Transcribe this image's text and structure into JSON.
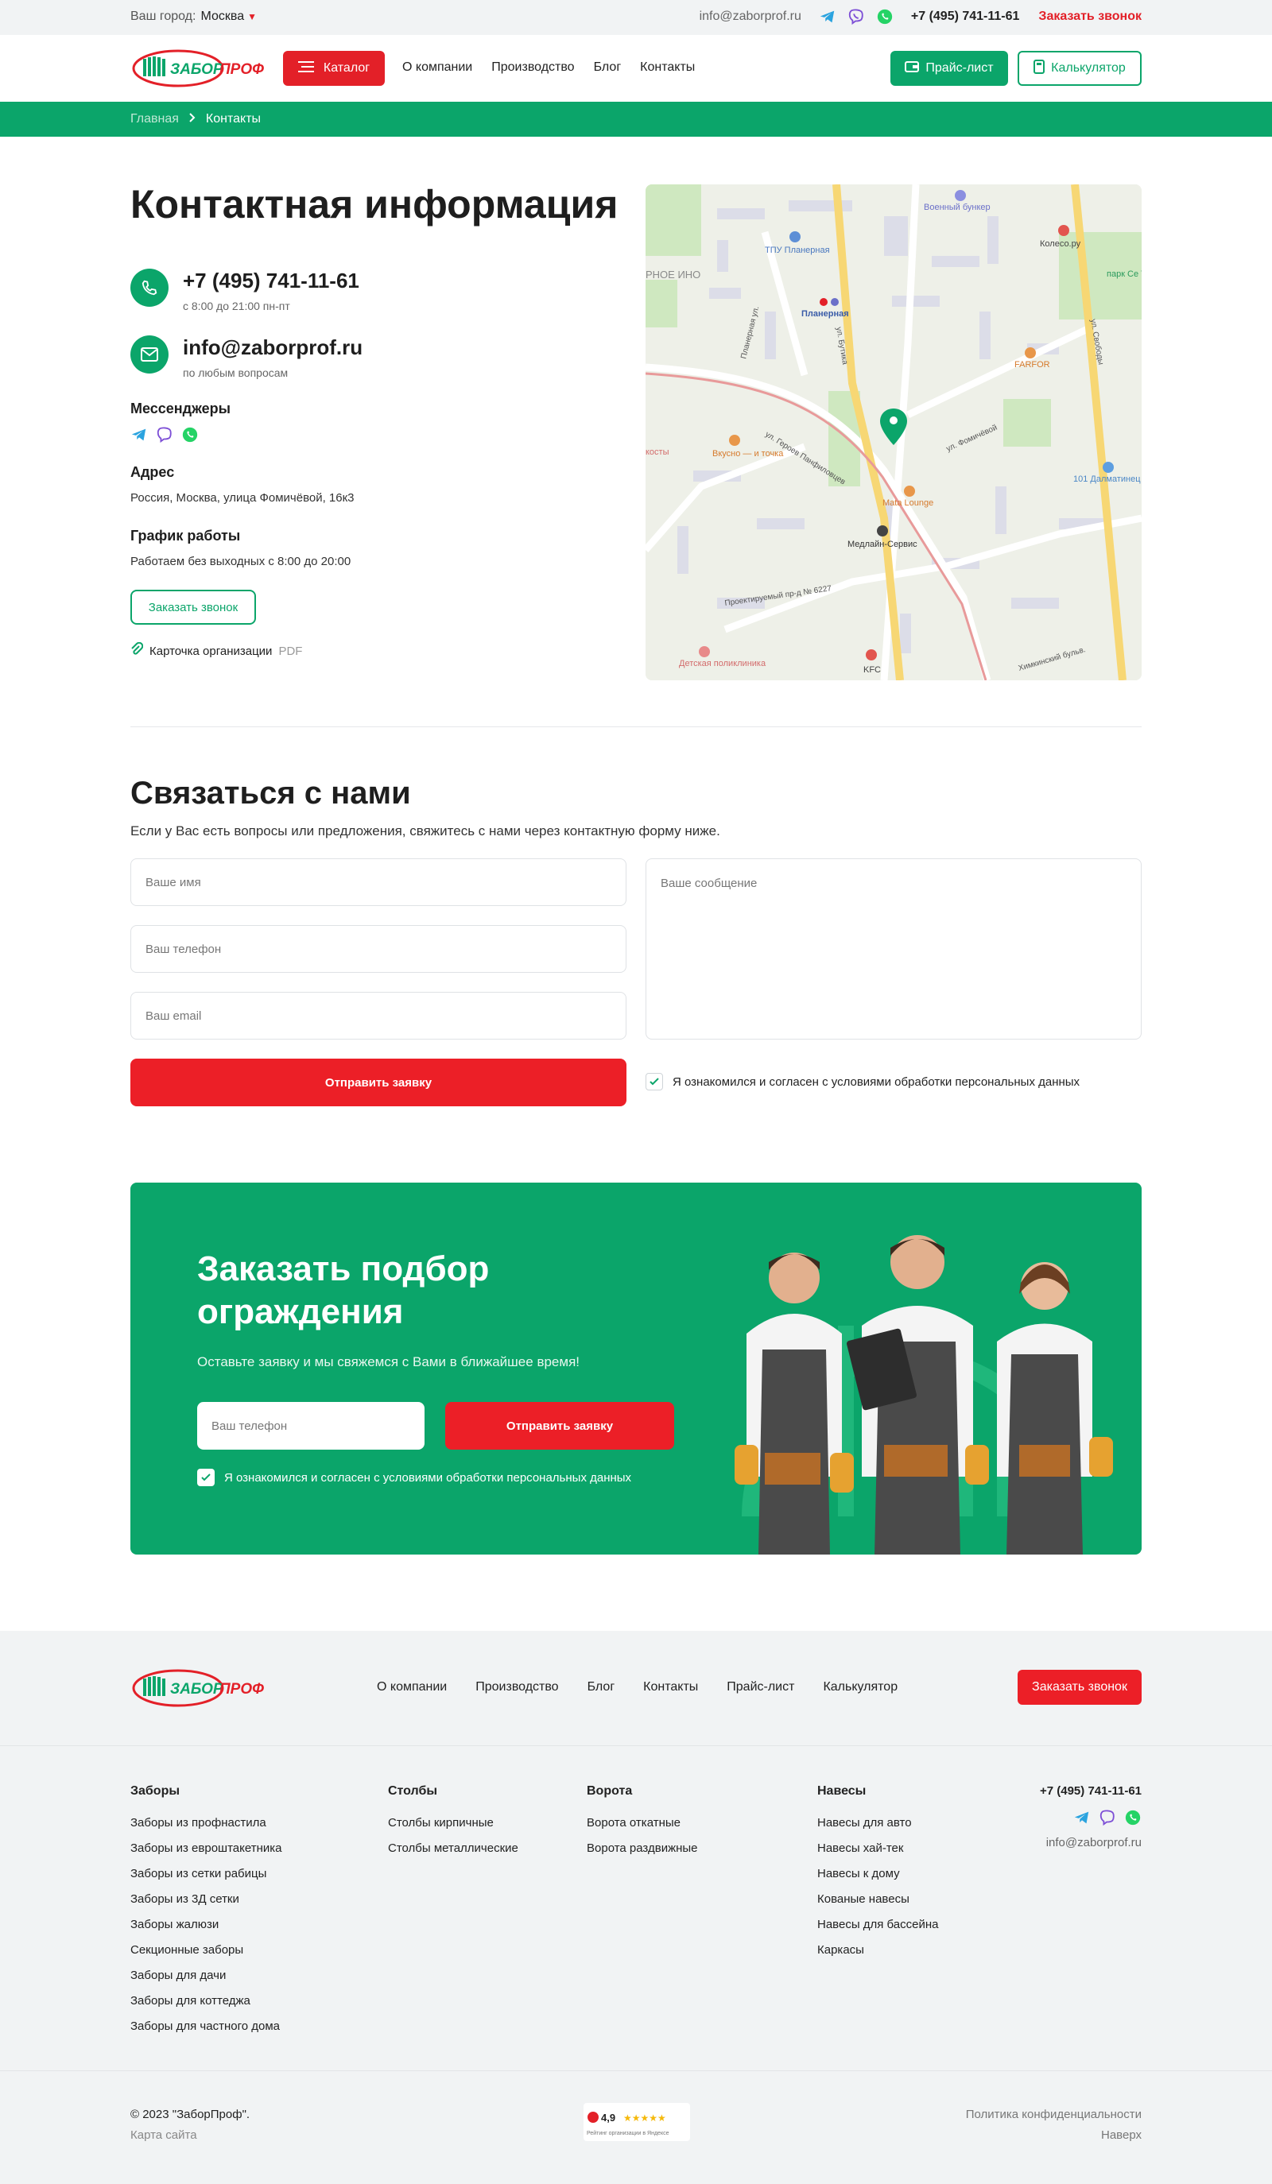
{
  "topbar": {
    "city_label": "Ваш город:",
    "city_value": "Москва",
    "email": "info@zaborprof.ru",
    "phone": "+7 (495) 741-11-61",
    "callback": "Заказать звонок"
  },
  "header": {
    "catalog": "Каталог",
    "nav": [
      "О компании",
      "Производство",
      "Блог",
      "Контакты"
    ],
    "price_list": "Прайс-лист",
    "calculator": "Калькулятор"
  },
  "breadcrumb": {
    "home": "Главная",
    "current": "Контакты"
  },
  "contacts": {
    "title": "Контактная информация",
    "phone": "+7 (495) 741-11-61",
    "phone_hours": "с 8:00 до 21:00 пн-пт",
    "email": "info@zaborprof.ru",
    "email_note": "по любым вопросам",
    "messengers_label": "Мессенджеры",
    "address_label": "Адрес",
    "address": "Россия, Москва, улица Фомичёвой, 16к3",
    "schedule_label": "График работы",
    "schedule": "Работаем без выходных с 8:00 до 20:00",
    "callback_btn": "Заказать звонок",
    "card_link": "Карточка организации",
    "card_format": "PDF"
  },
  "map": {
    "labels": {
      "bunker": "Военный бункер",
      "tpu": "ТПУ Планерная",
      "koleso": "Колесо.ру",
      "park": "парк Се Туш",
      "planernaya": "Планерная",
      "farfor": "FARFOR",
      "vkusno": "Вкусно — и точка",
      "mata": "Mata Lounge",
      "dalmatin": "101 Далматинец",
      "medline": "Медлайн-Сервис",
      "poliklinika": "Детская поликлиника",
      "kfc": "KFC",
      "street_panfilovtsev": "ул. Героев Панфиловцев",
      "street_fomichevoy": "ул. Фомичёвой",
      "street_svobody": "ул. Свободы",
      "street_planernaya": "Планерная ул.",
      "street_bulgeva": "ул. Бутика",
      "proezd": "Проектируемый пр-д № 6227",
      "himki": "Химкинский бульв.",
      "zone": "РНОЕ ИНО",
      "kosty": "косты"
    }
  },
  "form": {
    "title": "Связаться с нами",
    "subtitle": "Если у Вас есть вопросы или предложения, свяжитесь с нами через контактную форму ниже.",
    "name_placeholder": "Ваше имя",
    "phone_placeholder": "Ваш телефон",
    "email_placeholder": "Ваш email",
    "message_placeholder": "Ваше сообщение",
    "submit": "Отправить заявку",
    "agree": "Я ознакомился и согласен с условиями обработки персональных данных"
  },
  "cta": {
    "title": "Заказать подбор ограждения",
    "subtitle": "Оставьте заявку и мы свяжемся с Вами в ближайшее время!",
    "phone_placeholder": "Ваш телефон",
    "submit": "Отправить заявку",
    "agree": "Я ознакомился и согласен с условиями обработки персональных данных"
  },
  "footer": {
    "nav": [
      "О компании",
      "Производство",
      "Блог",
      "Контакты",
      "Прайс-лист",
      "Калькулятор"
    ],
    "callback": "Заказать звонок",
    "columns": [
      {
        "title": "Заборы",
        "items": [
          "Заборы из профнастила",
          "Заборы из евроштакетника",
          "Заборы из сетки рабицы",
          "Заборы из 3Д сетки",
          "Заборы жалюзи",
          "Секционные заборы",
          "Заборы для дачи",
          "Заборы для коттеджа",
          "Заборы для частного дома"
        ]
      },
      {
        "title": "Столбы",
        "items": [
          "Столбы кирпичные",
          "Столбы металлические"
        ]
      },
      {
        "title": "Ворота",
        "items": [
          "Ворота откатные",
          "Ворота раздвижные"
        ]
      },
      {
        "title": "Навесы",
        "items": [
          "Навесы для авто",
          "Навесы хай-тек",
          "Навесы к дому",
          "Кованые навесы",
          "Навесы для бассейна",
          "Каркасы"
        ]
      }
    ],
    "phone": "+7 (495) 741-11-61",
    "email": "info@zaborprof.ru",
    "copyright": "© 2023 \"ЗаборПроф\".",
    "sitemap": "Карта сайта",
    "rating": "4,9",
    "rating_caption": "Рейтинг организации в Яндексе",
    "policy": "Политика конфиденциальности",
    "up": "Наверх"
  },
  "logo_text": "ЗаборПроф",
  "colors": {
    "green": "#0ba56a",
    "red": "#e32028",
    "bg_gray": "#f1f3f4"
  }
}
